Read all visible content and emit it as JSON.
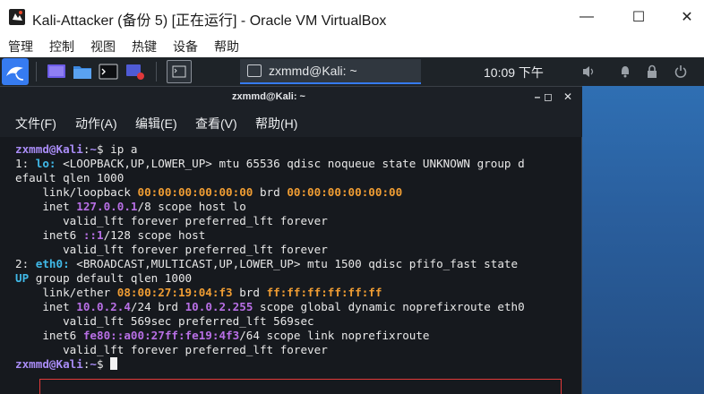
{
  "window": {
    "title": "Kali-Attacker (备份 5) [正在运行] - Oracle VM VirtualBox",
    "controls": {
      "minimize": "—",
      "maximize": "☐",
      "close": "✕"
    }
  },
  "vbox_menu": [
    "管理",
    "控制",
    "视图",
    "热键",
    "设备",
    "帮助"
  ],
  "panel": {
    "task_label": "zxmmd@Kali: ~",
    "clock": "10:09 下午",
    "tray_icons": [
      "volume-icon",
      "notification-bell-icon",
      "lock-icon",
      "power-icon"
    ]
  },
  "terminal": {
    "title": "zxmmd@Kali: ~",
    "controls": [
      "–",
      "◻",
      "✕"
    ],
    "menu": [
      "文件(F)",
      "动作(A)",
      "编辑(E)",
      "查看(V)",
      "帮助(H)"
    ],
    "lines": [
      [
        {
          "t": "zxmmd@Kali",
          "c": "user"
        },
        {
          "t": ":",
          "c": ""
        },
        {
          "t": "~",
          "c": "user"
        },
        {
          "t": "$ ip a",
          "c": ""
        }
      ],
      [
        {
          "t": "1: ",
          "c": ""
        },
        {
          "t": "lo:",
          "c": "cyan"
        },
        {
          "t": " <LOOPBACK,UP,LOWER_UP> mtu 65536 qdisc noqueue state UNKNOWN group d",
          "c": ""
        }
      ],
      [
        {
          "t": "efault qlen 1000",
          "c": ""
        }
      ],
      [
        {
          "t": "    link/loopback ",
          "c": ""
        },
        {
          "t": "00:00:00:00:00:00",
          "c": "orange"
        },
        {
          "t": " brd ",
          "c": ""
        },
        {
          "t": "00:00:00:00:00:00",
          "c": "orange"
        }
      ],
      [
        {
          "t": "    inet ",
          "c": ""
        },
        {
          "t": "127.0.0.1",
          "c": "purple"
        },
        {
          "t": "/8 scope host lo",
          "c": ""
        }
      ],
      [
        {
          "t": "       valid_lft forever preferred_lft forever",
          "c": ""
        }
      ],
      [
        {
          "t": "    inet6 ",
          "c": ""
        },
        {
          "t": "::1",
          "c": "purple"
        },
        {
          "t": "/128 scope host",
          "c": ""
        }
      ],
      [
        {
          "t": "       valid_lft forever preferred_lft forever",
          "c": ""
        }
      ],
      [
        {
          "t": "2: ",
          "c": ""
        },
        {
          "t": "eth0:",
          "c": "cyan"
        },
        {
          "t": " <BROADCAST,MULTICAST,UP,LOWER_UP> mtu 1500 qdisc pfifo_fast state",
          "c": ""
        }
      ],
      [
        {
          "t": "UP",
          "c": "cyan"
        },
        {
          "t": " group default qlen 1000",
          "c": ""
        }
      ],
      [
        {
          "t": "    link/ether ",
          "c": ""
        },
        {
          "t": "08:00:27:19:04:f3",
          "c": "orange"
        },
        {
          "t": " brd ",
          "c": ""
        },
        {
          "t": "ff:ff:ff:ff:ff:ff",
          "c": "orange"
        }
      ],
      [
        {
          "t": "    inet ",
          "c": ""
        },
        {
          "t": "10.0.2.4",
          "c": "purple"
        },
        {
          "t": "/24 brd ",
          "c": ""
        },
        {
          "t": "10.0.2.255",
          "c": "purple"
        },
        {
          "t": " scope global dynamic noprefixroute eth0",
          "c": ""
        }
      ],
      [
        {
          "t": "       valid_lft 569sec preferred_lft 569sec",
          "c": ""
        }
      ],
      [
        {
          "t": "    inet6 ",
          "c": ""
        },
        {
          "t": "fe80::a00:27ff:fe19:4f3",
          "c": "purple"
        },
        {
          "t": "/64 scope link noprefixroute",
          "c": ""
        }
      ],
      [
        {
          "t": "       valid_lft forever preferred_lft forever",
          "c": ""
        }
      ],
      [
        {
          "t": "zxmmd@Kali",
          "c": "user"
        },
        {
          "t": ":",
          "c": ""
        },
        {
          "t": "~",
          "c": "user"
        },
        {
          "t": "$ ",
          "c": ""
        }
      ]
    ],
    "highlighted_line": 11
  },
  "colors": {
    "terminal_bg": "#16191e",
    "prompt": "#a98cf6",
    "interface_name": "#40b9e8",
    "mac_address": "#f09d33",
    "ip_address": "#b86fe5",
    "highlight_box": "#e23a3a",
    "kali_accent": "#367bf0"
  }
}
